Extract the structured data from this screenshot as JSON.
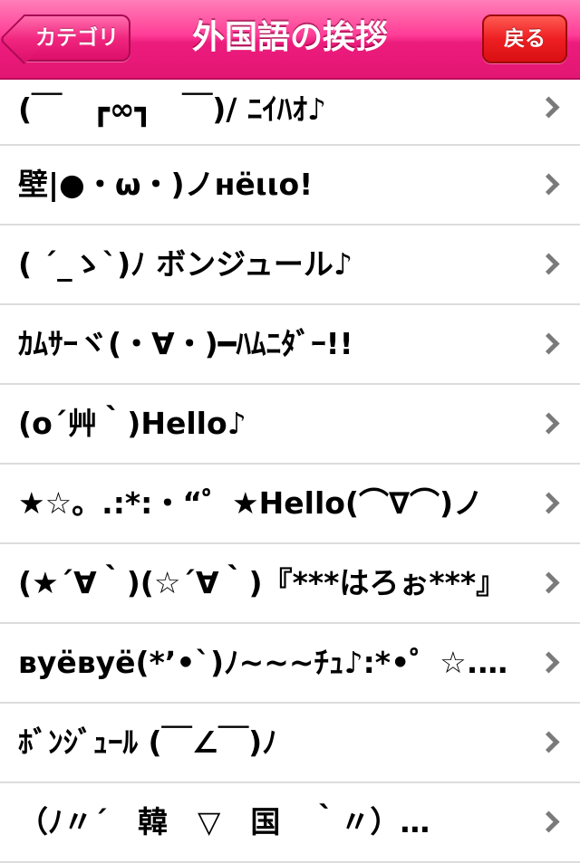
{
  "navbar": {
    "back_label": "カテゴリ",
    "title": "外国語の挨拶",
    "return_label": "戻る"
  },
  "list": {
    "items": [
      "(￣　┏∞┓　￣)/ ﾆｲﾊｵ♪",
      "壁|●・ω・)ノнёιιo!",
      "( ´_ゝ`)ﾉ ボンジュール♪",
      "ｶﾑｻｰヾ(・∀・)━ﾊﾑﾆﾀﾞｰ!!",
      "(o´艸｀)Hello♪",
      "★☆。.:*:・“゜★Hello(⌒∇⌒)ノ",
      "(★´∀｀)(☆´∀｀)『***はろぉ***』",
      "вуёвуё(*’•`)ﾉ~~~ﾁｭ♪:*•゜☆.｡.:",
      "ﾎﾞﾝｼﾞｭｰﾙ (￣∠￣)ﾉ",
      "（ﾉ〃´　韓　▽　国　｀〃）…"
    ]
  },
  "colors": {
    "navbar_pink": "#ec1c7c",
    "return_red": "#ee1f22",
    "separator": "#dcdcdc",
    "chevron": "#7a7a7a"
  }
}
